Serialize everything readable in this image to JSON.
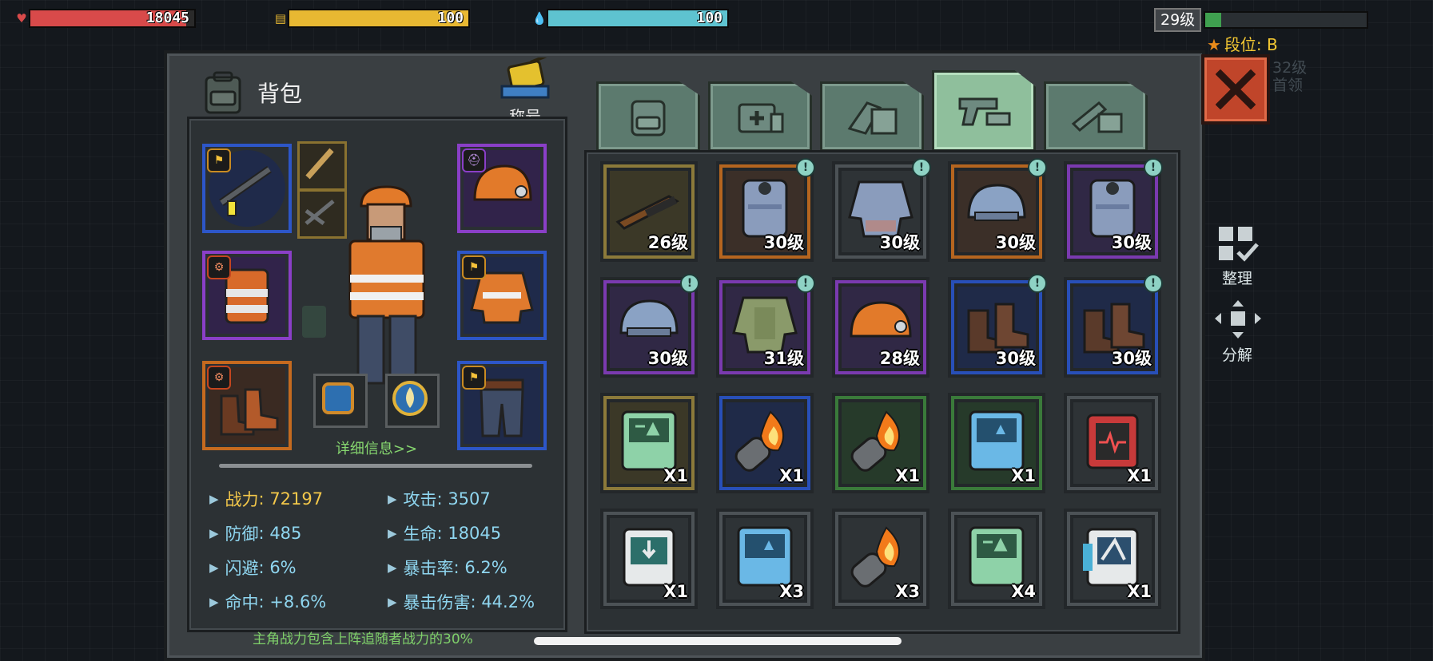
{
  "hud": {
    "health": {
      "value": "18045",
      "fill": 0.95,
      "color": "#d84a4a",
      "icon": "heart-icon"
    },
    "energy": {
      "value": "100",
      "fill": 1.0,
      "color": "#e8b832",
      "icon": "food-icon"
    },
    "water": {
      "value": "100",
      "fill": 1.0,
      "color": "#5ec3d0",
      "icon": "water-drop-icon"
    },
    "level": "29级",
    "xp_fill": 0.1,
    "rank": "段位: B",
    "bg_hint_1": "32级",
    "bg_hint_2": "首领"
  },
  "panel": {
    "bag_title": "背包",
    "title_label": "称号",
    "close_icon": "close-icon"
  },
  "tabs": [
    {
      "name": "tab-backpack",
      "icon": "backpack-icon",
      "active": false
    },
    {
      "name": "tab-medical",
      "icon": "medkit-icon",
      "active": false
    },
    {
      "name": "tab-materials",
      "icon": "materials-icon",
      "active": false
    },
    {
      "name": "tab-weapons",
      "icon": "pistol-icon",
      "active": true
    },
    {
      "name": "tab-tools",
      "icon": "wrench-icon",
      "active": false
    }
  ],
  "equipment": {
    "details_link": "详细信息>>",
    "stats": [
      {
        "label": "战力",
        "value": "72197"
      },
      {
        "label": "攻击",
        "value": "3507"
      },
      {
        "label": "防御",
        "value": "485"
      },
      {
        "label": "生命",
        "value": "18045"
      },
      {
        "label": "闪避",
        "value": "6%"
      },
      {
        "label": "暴击率",
        "value": "6.2%"
      },
      {
        "label": "命中",
        "value": "+8.6%"
      },
      {
        "label": "暴击伤害",
        "value": "44.2%"
      }
    ],
    "footnote": "主角战力包含上阵追随者战力的30%"
  },
  "inventory": [
    {
      "item": "rifle",
      "badge": "26级",
      "rarity": "gold",
      "new": false
    },
    {
      "item": "vest",
      "badge": "30级",
      "rarity": "orange",
      "new": true
    },
    {
      "item": "armor-jacket",
      "badge": "30级",
      "rarity": "gray",
      "new": true
    },
    {
      "item": "helmet",
      "badge": "30级",
      "rarity": "orange",
      "new": true
    },
    {
      "item": "vest",
      "badge": "30级",
      "rarity": "purple",
      "new": true
    },
    {
      "item": "helmet",
      "badge": "30级",
      "rarity": "purple",
      "new": true
    },
    {
      "item": "green-armor",
      "badge": "31级",
      "rarity": "purple",
      "new": true
    },
    {
      "item": "hard-hat",
      "badge": "28级",
      "rarity": "purple",
      "new": false
    },
    {
      "item": "boots",
      "badge": "30级",
      "rarity": "blue",
      "new": true
    },
    {
      "item": "boots",
      "badge": "30级",
      "rarity": "blue",
      "new": true
    },
    {
      "item": "green-terminal",
      "badge": "X1",
      "rarity": "gold",
      "new": false
    },
    {
      "item": "fire-grenade",
      "badge": "X1",
      "rarity": "blue",
      "new": false
    },
    {
      "item": "fire-grenade",
      "badge": "X1",
      "rarity": "green",
      "new": false
    },
    {
      "item": "blue-terminal",
      "badge": "X1",
      "rarity": "green",
      "new": false
    },
    {
      "item": "heart-monitor",
      "badge": "X1",
      "rarity": "gray",
      "new": false
    },
    {
      "item": "white-device",
      "badge": "X1",
      "rarity": "gray",
      "new": false
    },
    {
      "item": "blue-terminal",
      "badge": "X3",
      "rarity": "gray",
      "new": false
    },
    {
      "item": "fire-grenade",
      "badge": "X3",
      "rarity": "gray",
      "new": false
    },
    {
      "item": "green-terminal",
      "badge": "X4",
      "rarity": "gray",
      "new": false
    },
    {
      "item": "scanner-device",
      "badge": "X1",
      "rarity": "gray",
      "new": false
    }
  ],
  "side": {
    "organize": "整理",
    "decompose": "分解"
  }
}
